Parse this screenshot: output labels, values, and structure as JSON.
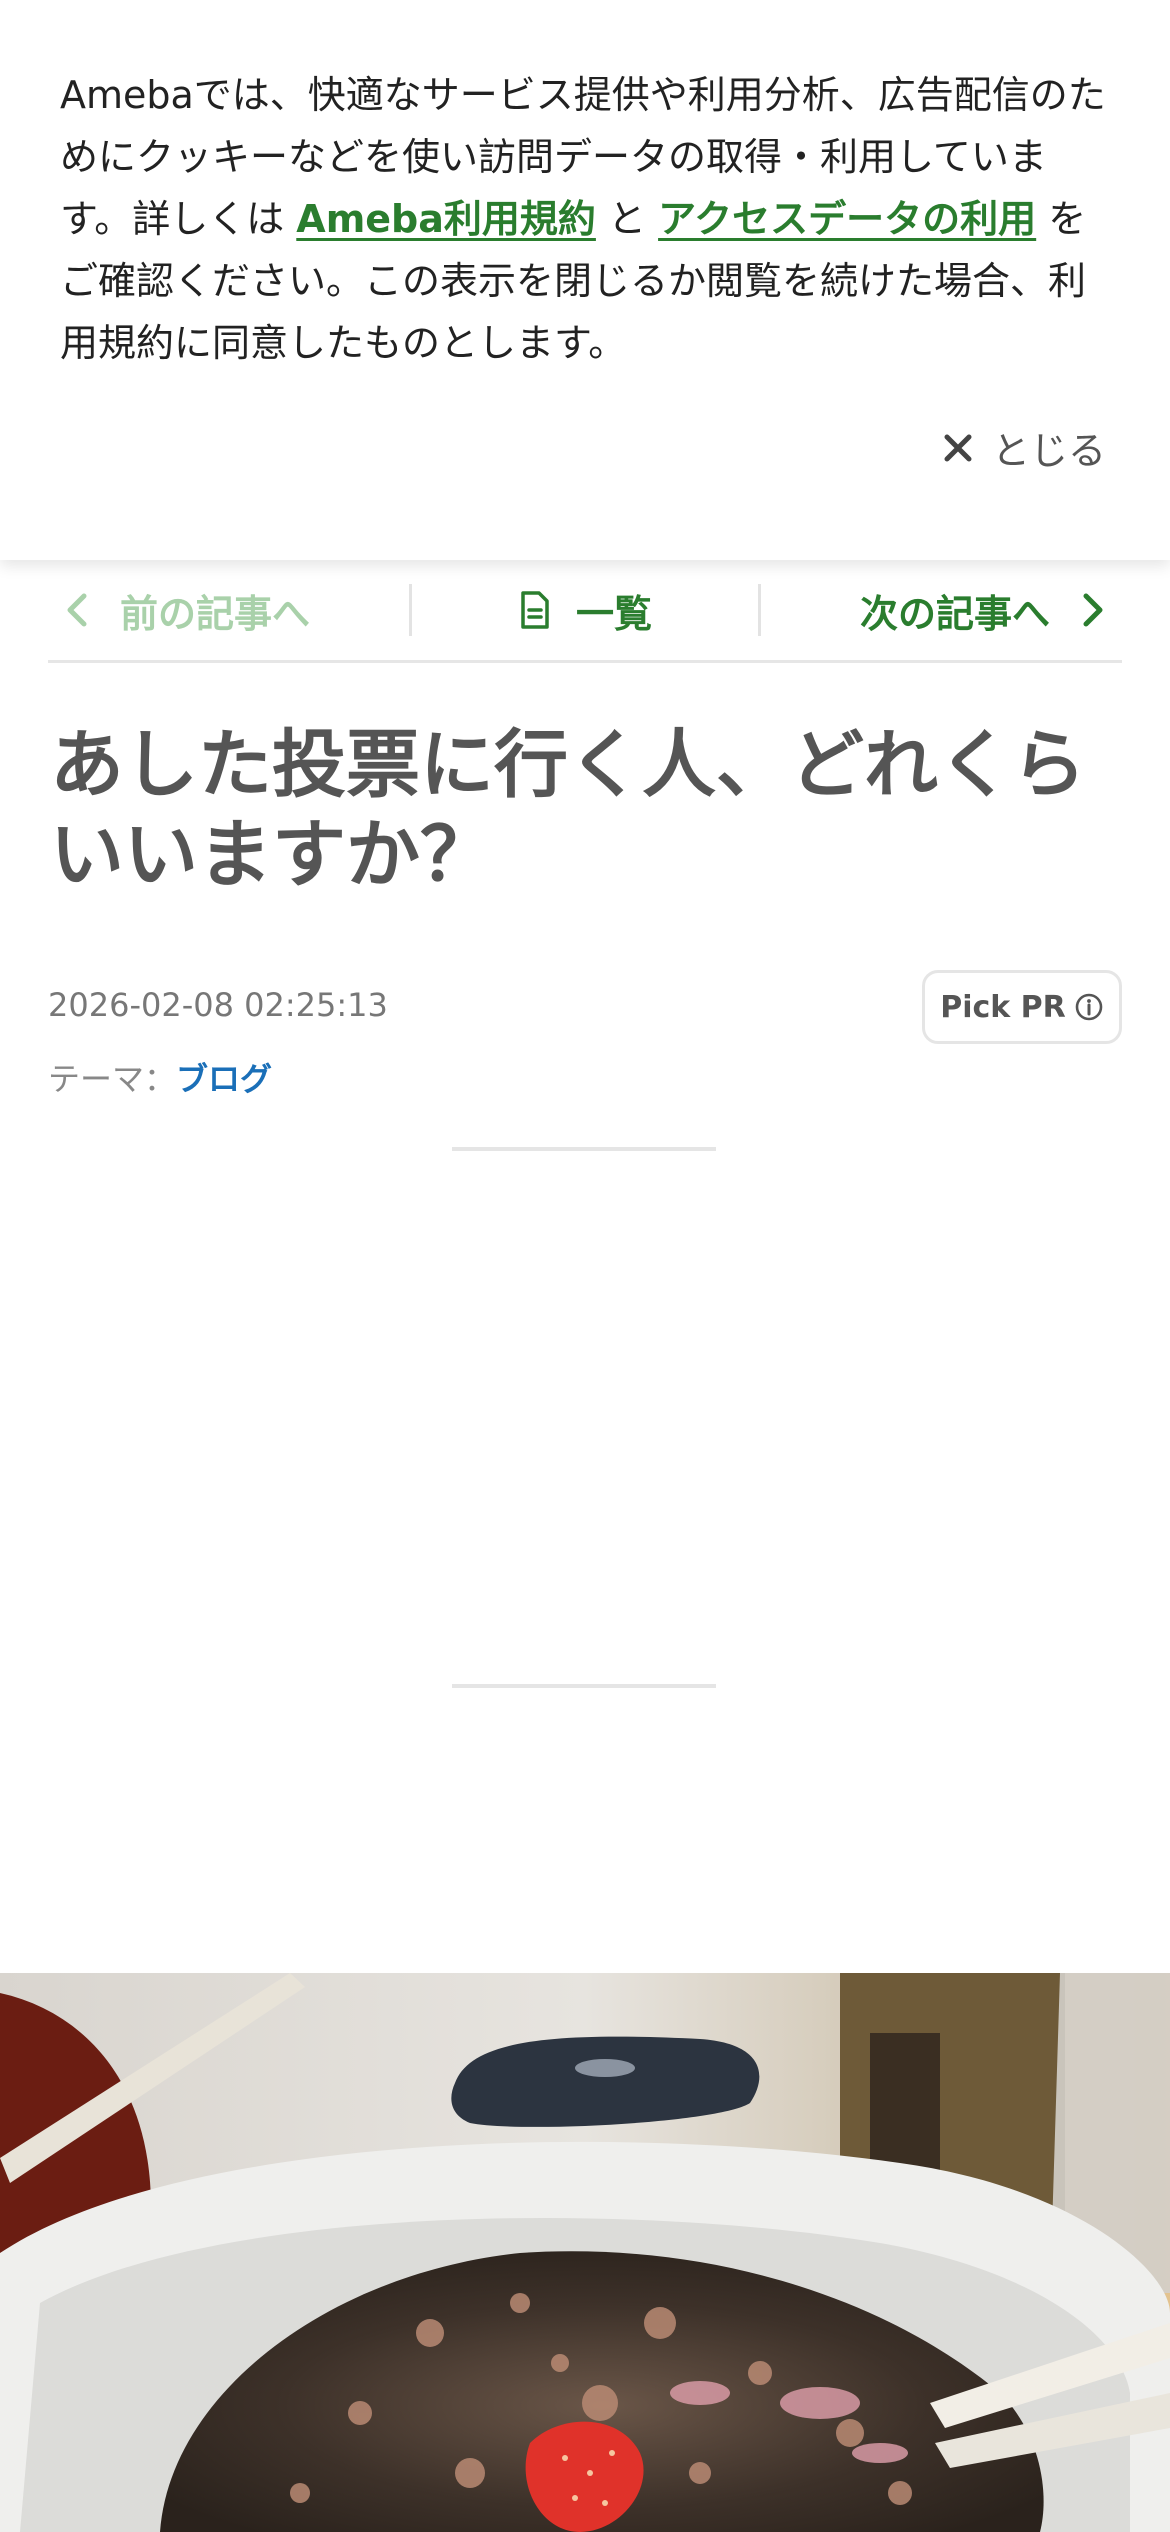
{
  "cookie_banner": {
    "text_1": "Amebaでは、快適なサービス提供や利用分析、広告配信のためにクッキーなどを使い訪問データの取得・利用しています。詳しくは ",
    "link_terms": "Ameba利用規約",
    "text_2": " と ",
    "link_access": "アクセスデータの利用",
    "text_3": " をご確認ください。この表示を閉じるか閲覧を続けた場合、利用規約に同意したものとします。",
    "close_label": "とじる"
  },
  "nav": {
    "prev_label": "前の記事へ",
    "list_label": "一覧",
    "next_label": "次の記事へ"
  },
  "article": {
    "title": "あした投票に行く人、どれくらいいますか？",
    "date": "2026-02-08 02:25:13",
    "theme_label": "テーマ：",
    "theme_value": "ブログ",
    "pickpr_label": "Pick PR"
  },
  "colors": {
    "accent_green": "#2a7d2e",
    "link_blue": "#1a6fb8"
  }
}
